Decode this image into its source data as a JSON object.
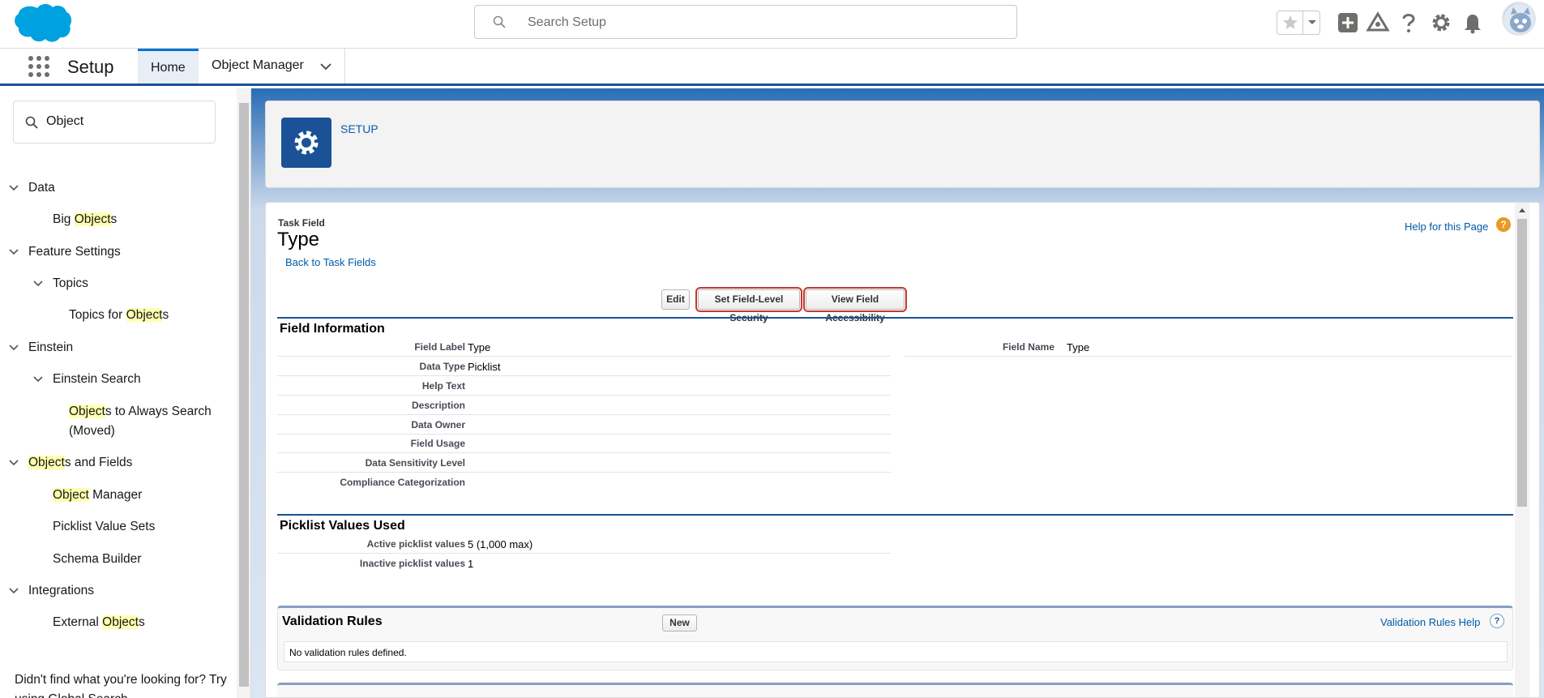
{
  "header": {
    "search_placeholder": "Search Setup",
    "icons": [
      "salesforce-cloud-logo",
      "search-icon",
      "star-icon",
      "caret-down-icon",
      "plus-icon",
      "trailhead-icon",
      "help-icon",
      "gear-icon",
      "bell-icon",
      "avatar"
    ]
  },
  "context": {
    "app_name": "Setup",
    "tabs": [
      {
        "label": "Home",
        "active": true
      },
      {
        "label": "Object Manager",
        "active": false
      }
    ]
  },
  "sidebar": {
    "search_value": "Object",
    "footer": "Didn't find what you're looking for? Try using Global Search."
  },
  "setup_card": {
    "label": "SETUP"
  },
  "page": {
    "object_type": "Task Field",
    "title": "Type",
    "back_link": "Back to Task Fields",
    "help_link": "Help for this Page",
    "buttons": {
      "edit": "Edit",
      "fls": "Set Field-Level Security",
      "access": "View Field Accessibility"
    }
  },
  "field_info": {
    "heading": "Field Information",
    "rows": [
      {
        "label": "Field Label",
        "value": "Type"
      },
      {
        "label": "Data Type",
        "value": "Picklist"
      },
      {
        "label": "Help Text",
        "value": ""
      },
      {
        "label": "Description",
        "value": ""
      },
      {
        "label": "Data Owner",
        "value": ""
      },
      {
        "label": "Field Usage",
        "value": ""
      },
      {
        "label": "Data Sensitivity Level",
        "value": ""
      },
      {
        "label": "Compliance Categorization",
        "value": ""
      }
    ],
    "field_name_label": "Field Name",
    "field_name_value": "Type"
  },
  "picklist": {
    "heading": "Picklist Values Used",
    "rows": [
      {
        "label": "Active picklist values",
        "value": "5 (1,000 max)"
      },
      {
        "label": "Inactive picklist values",
        "value": "1"
      }
    ]
  },
  "validation": {
    "heading": "Validation Rules",
    "new_label": "New",
    "help_link": "Validation Rules Help",
    "empty": "No validation rules defined."
  },
  "colors": {
    "brand": "#1b5297",
    "link": "#015ba7",
    "highlight": "#c23934",
    "match": "#ffffb0"
  }
}
